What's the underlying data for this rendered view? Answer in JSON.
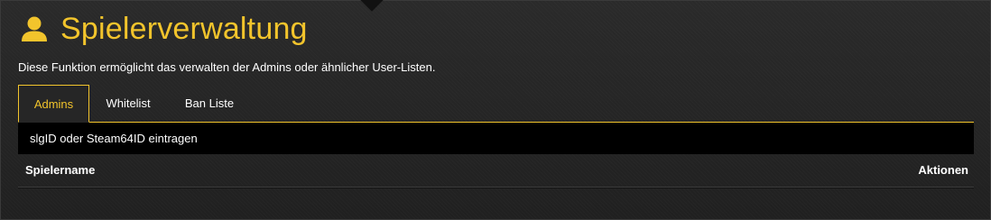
{
  "header": {
    "title": "Spielerverwaltung",
    "icon": "user-icon",
    "accent_color": "#f2c42c"
  },
  "description": "Diese Funktion ermöglicht das verwalten der Admins oder ähnlicher User-Listen.",
  "tabs": [
    {
      "label": "Admins",
      "active": true
    },
    {
      "label": "Whitelist",
      "active": false
    },
    {
      "label": "Ban Liste",
      "active": false
    }
  ],
  "input": {
    "placeholder": "slgID oder Steam64ID eintragen",
    "value": ""
  },
  "table": {
    "columns": [
      "Spielername",
      "Aktionen"
    ],
    "rows": []
  }
}
